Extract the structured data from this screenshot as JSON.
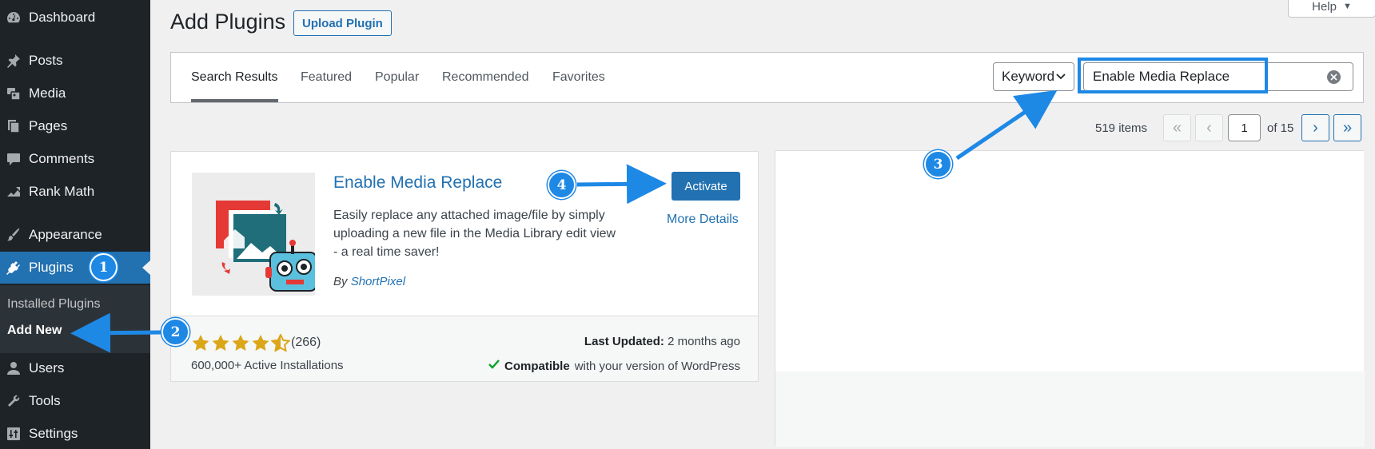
{
  "sidebar": {
    "items": [
      {
        "label": "Dashboard",
        "icon": "dashboard-icon"
      },
      {
        "label": "Posts",
        "icon": "pin-icon"
      },
      {
        "label": "Media",
        "icon": "media-icon"
      },
      {
        "label": "Pages",
        "icon": "pages-icon"
      },
      {
        "label": "Comments",
        "icon": "comment-icon"
      },
      {
        "label": "Rank Math",
        "icon": "chart-icon"
      },
      {
        "label": "Appearance",
        "icon": "brush-icon"
      },
      {
        "label": "Plugins",
        "icon": "plug-icon"
      },
      {
        "label": "Users",
        "icon": "user-icon"
      },
      {
        "label": "Tools",
        "icon": "wrench-icon"
      },
      {
        "label": "Settings",
        "icon": "sliders-icon"
      }
    ],
    "submenu": {
      "installed": "Installed Plugins",
      "add_new": "Add New"
    }
  },
  "header": {
    "title": "Add Plugins",
    "upload_label": "Upload Plugin",
    "help_label": "Help"
  },
  "tabs": [
    {
      "label": "Search Results"
    },
    {
      "label": "Featured"
    },
    {
      "label": "Popular"
    },
    {
      "label": "Recommended"
    },
    {
      "label": "Favorites"
    }
  ],
  "search": {
    "type_value": "Keyword",
    "query": "Enable Media Replace"
  },
  "pagination": {
    "items": "519 items",
    "first": "«",
    "prev": "‹",
    "current": "1",
    "of": "of 15",
    "next": "›",
    "last": "»"
  },
  "plugin": {
    "name": "Enable Media Replace",
    "description": "Easily replace any attached image/file by simply uploading a new file in the Media Library edit view - a real time saver!",
    "author_prefix": "By",
    "author": "ShortPixel",
    "activate_label": "Activate",
    "more_details": "More Details",
    "rating": 4.5,
    "rating_count": "(266)",
    "installs": "600,000+ Active Installations",
    "last_updated_label": "Last Updated:",
    "last_updated_value": "2 months ago",
    "compat_strong": "Compatible",
    "compat_rest": "with your version of WordPress"
  },
  "annotations": {
    "b1": "1",
    "b2": "2",
    "b3": "3",
    "b4": "4",
    "color": "#1e88e5"
  },
  "colors": {
    "sidebar": "#1d2327",
    "accent": "#2271b1",
    "star": "#dba617"
  }
}
